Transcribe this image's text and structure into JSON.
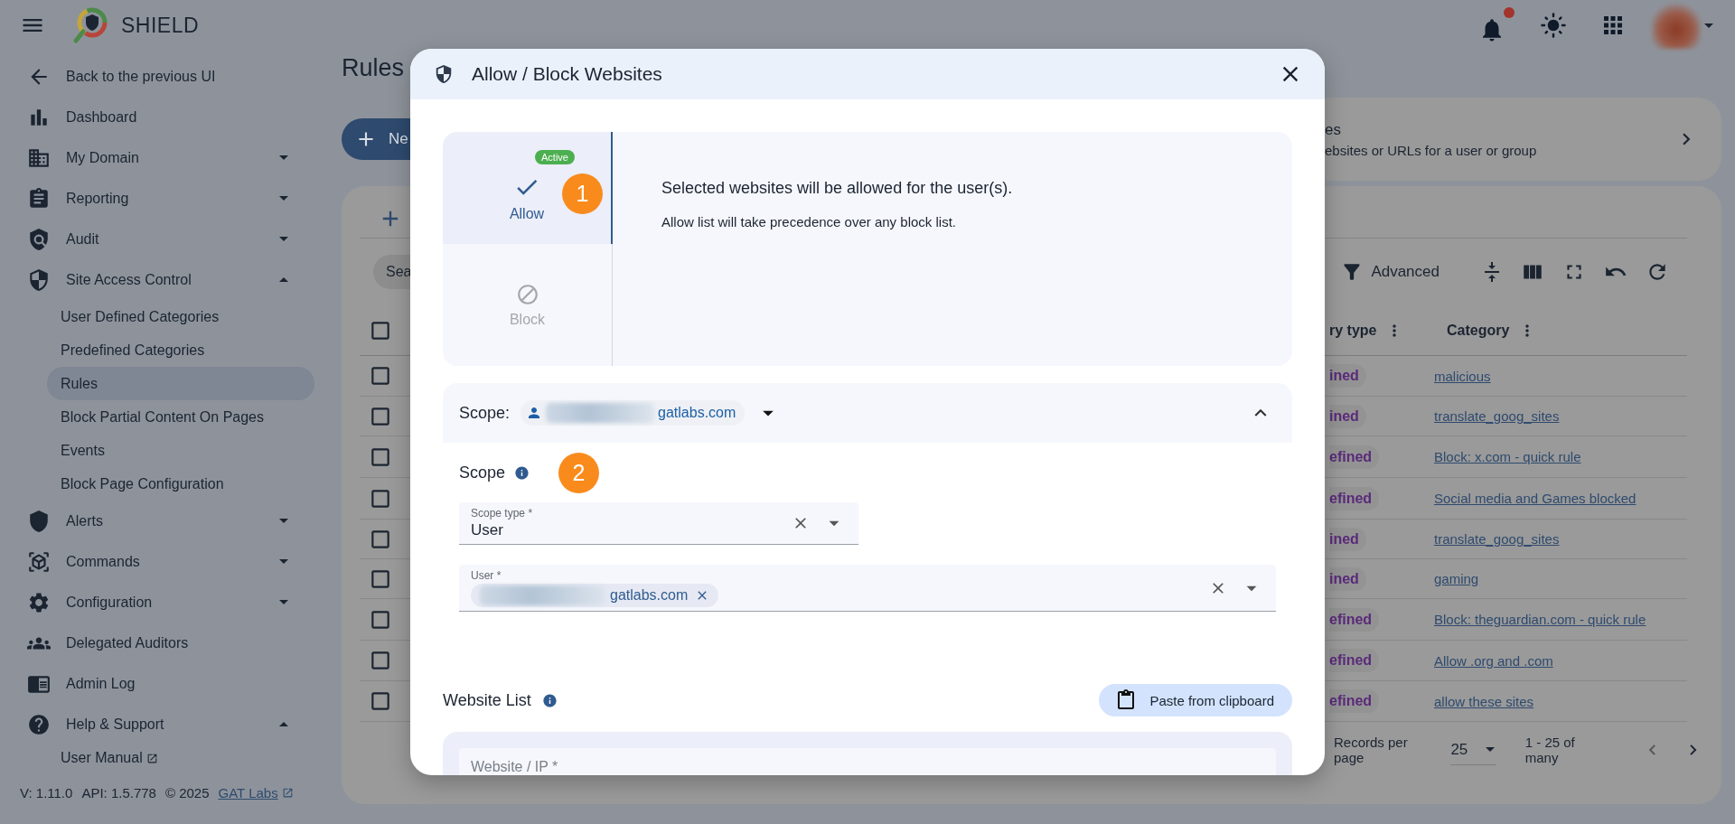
{
  "app": {
    "title": "SHIELD"
  },
  "sidebar": {
    "back": "Back to the previous UI",
    "items": [
      {
        "label": "Dashboard"
      },
      {
        "label": "My Domain",
        "expanded": false
      },
      {
        "label": "Reporting",
        "expanded": false
      },
      {
        "label": "Audit",
        "expanded": false
      },
      {
        "label": "Site Access Control",
        "expanded": true,
        "children": [
          {
            "label": "User Defined Categories",
            "selected": false
          },
          {
            "label": "Predefined Categories",
            "selected": false
          },
          {
            "label": "Rules",
            "selected": true
          },
          {
            "label": "Block Partial Content On Pages",
            "selected": false
          },
          {
            "label": "Events",
            "selected": false
          },
          {
            "label": "Block Page Configuration",
            "selected": false
          }
        ]
      },
      {
        "label": "Alerts",
        "expanded": false
      },
      {
        "label": "Commands",
        "expanded": false
      },
      {
        "label": "Configuration",
        "expanded": false
      },
      {
        "label": "Delegated Auditors"
      },
      {
        "label": "Admin Log"
      },
      {
        "label": "Help & Support",
        "expanded": true,
        "children": [
          {
            "label": "User Manual",
            "selected": false
          }
        ]
      }
    ],
    "footer": {
      "version": "V: 1.11.0",
      "api": "API: 1.5.778",
      "copyright": "© 2025",
      "link": "GAT Labs"
    }
  },
  "page": {
    "title": "Rules",
    "new_button": "Ne",
    "banner": {
      "title": "es",
      "subtitle": "ebsites or URLs for a user or group"
    },
    "search_placeholder": "Sea",
    "advanced": "Advanced",
    "header_checked": false,
    "columns": [
      "ry type",
      "Category"
    ],
    "rows": [
      {
        "checked": false,
        "type": "ined",
        "category": "malicious"
      },
      {
        "checked": false,
        "type": "ined",
        "category": "translate_goog_sites"
      },
      {
        "checked": false,
        "type": "efined",
        "category": "Block: x.com - quick rule"
      },
      {
        "checked": false,
        "type": "efined",
        "category": "Social media and Games blocked"
      },
      {
        "checked": false,
        "type": "ined",
        "category": "translate_goog_sites"
      },
      {
        "checked": false,
        "type": "ined",
        "category": "gaming"
      },
      {
        "checked": false,
        "type": "efined",
        "category": "Block: theguardian.com - quick rule"
      },
      {
        "checked": false,
        "type": "efined",
        "category": "Allow .org and .com"
      },
      {
        "checked": false,
        "type": "efined",
        "category": "allow these sites"
      }
    ],
    "pagination": {
      "label": "Records per page",
      "per_page": "25",
      "range": "1 - 25 of many"
    }
  },
  "modal": {
    "title": "Allow / Block Websites",
    "steps": [
      "1",
      "2"
    ],
    "modes": [
      {
        "kind": "allow",
        "label": "Allow",
        "selected": true,
        "badge": "Active"
      },
      {
        "kind": "block",
        "label": "Block",
        "selected": false
      }
    ],
    "description": "Selected websites will be allowed for the user(s).",
    "note": "Allow list will take precedence over any block list.",
    "scope": {
      "label": "Scope:",
      "chip": "gatlabs.com",
      "expanded": true,
      "section_title": "Scope",
      "scope_type": {
        "label": "Scope type *",
        "value": "User"
      },
      "user": {
        "label": "User *",
        "chip": "gatlabs.com"
      }
    },
    "website_list": {
      "title": "Website List",
      "paste_button": "Paste from clipboard",
      "field_label": "Website / IP *"
    }
  }
}
